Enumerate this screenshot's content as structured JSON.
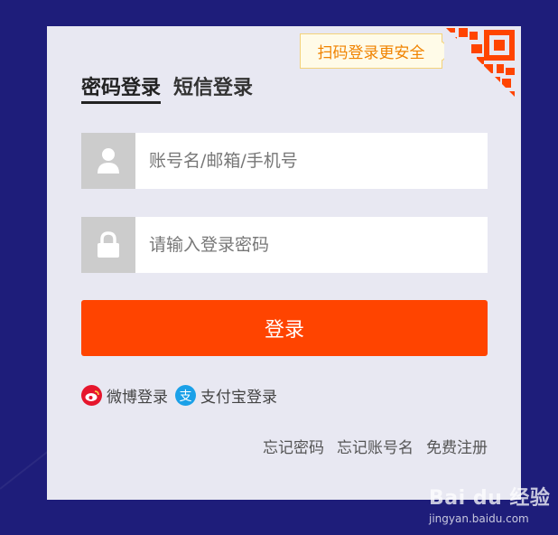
{
  "qr_tip": {
    "label": "扫码登录更安全"
  },
  "tabs": [
    {
      "label": "密码登录",
      "active": true
    },
    {
      "label": "短信登录",
      "active": false
    }
  ],
  "account_field": {
    "placeholder": "账号名/邮箱/手机号",
    "icon": "user-icon"
  },
  "password_field": {
    "placeholder": "请输入登录密码",
    "icon": "lock-icon"
  },
  "login_button": {
    "label": "登录"
  },
  "third_party": [
    {
      "label": "微博登录",
      "icon": "weibo-icon"
    },
    {
      "label": "支付宝登录",
      "icon": "alipay-icon",
      "icon_glyph": "支"
    }
  ],
  "links": {
    "forgot_password": "忘记密码",
    "forgot_account": "忘记账号名",
    "register": "免费注册"
  },
  "watermark": {
    "brand": "Bai du 经验",
    "url": "jingyan.baidu.com"
  },
  "colors": {
    "accent": "#ff4400",
    "qr_orange": "#ff4400",
    "tip_text": "#f08300",
    "background": "#1e1d7a",
    "panel": "#e8e8f2",
    "weibo": "#e6162d",
    "alipay": "#1aa0e8"
  }
}
